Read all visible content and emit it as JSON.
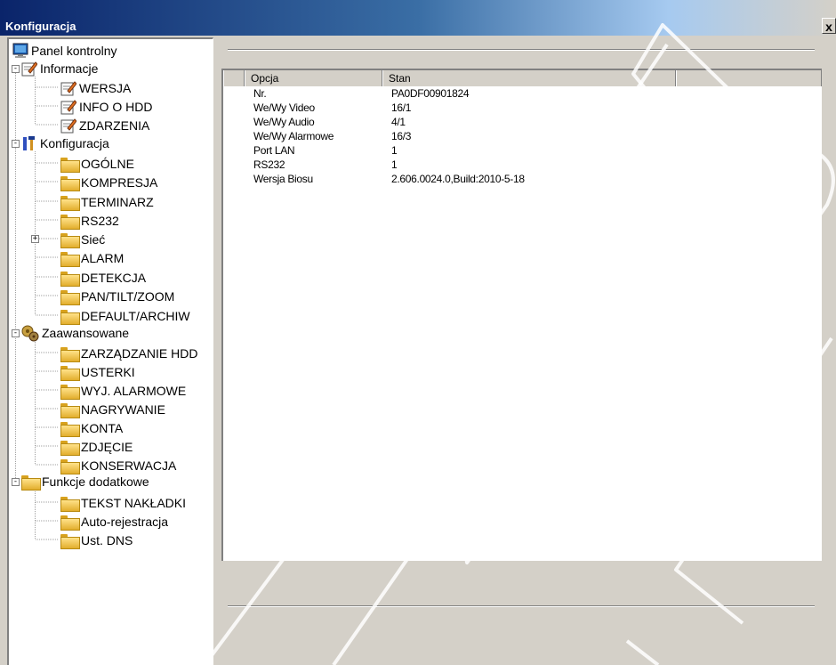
{
  "window": {
    "title": "Konfiguracja",
    "close_label": "x"
  },
  "tree": {
    "root": "Panel kontrolny",
    "informacje": {
      "label": "Informacje",
      "items": [
        "WERSJA",
        "INFO O HDD",
        "ZDARZENIA"
      ]
    },
    "konfiguracja": {
      "label": "Konfiguracja",
      "items": [
        "OGÓLNE",
        "KOMPRESJA",
        "TERMINARZ",
        "RS232",
        "Sieć",
        "ALARM",
        "DETEKCJA",
        "PAN/TILT/ZOOM",
        "DEFAULT/ARCHIW"
      ]
    },
    "zaawansowane": {
      "label": "Zaawansowane",
      "items": [
        "ZARZĄDZANIE HDD",
        "USTERKI",
        "WYJ. ALARMOWE",
        "NAGRYWANIE",
        "KONTA",
        "ZDJĘCIE",
        "KONSERWACJA"
      ]
    },
    "funkcje": {
      "label": "Funkcje dodatkowe",
      "items": [
        "TEKST NAKŁADKI",
        "Auto-rejestracja",
        "Ust. DNS"
      ]
    },
    "expand_minus": "-",
    "expand_plus": "+"
  },
  "table": {
    "headers": [
      "Opcja",
      "Stan"
    ],
    "rows": [
      {
        "opcja": "Nr.",
        "stan": "PA0DF00901824"
      },
      {
        "opcja": "We/Wy Video",
        "stan": "16/1"
      },
      {
        "opcja": "We/Wy Audio",
        "stan": "4/1"
      },
      {
        "opcja": "We/Wy Alarmowe",
        "stan": "16/3"
      },
      {
        "opcja": "Port LAN",
        "stan": "1"
      },
      {
        "opcja": "RS232",
        "stan": "1"
      },
      {
        "opcja": "Wersja Biosu",
        "stan": "2.606.0024.0,Build:2010-5-18"
      }
    ]
  },
  "colors": {
    "titlebar": "#0a246a",
    "face": "#d4d0c8",
    "folder": "#f0c24a"
  }
}
